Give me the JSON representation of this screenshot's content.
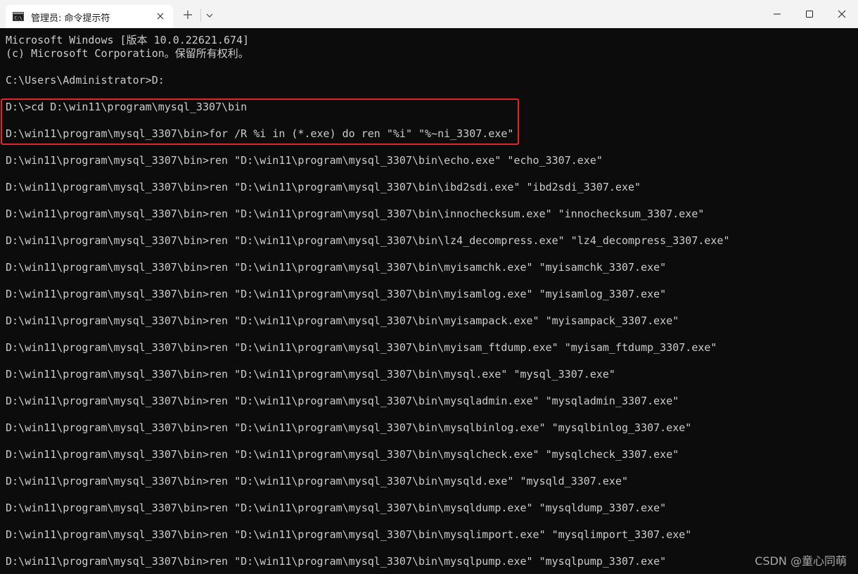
{
  "window": {
    "tab_title": "管理员: 命令提示符",
    "tab_icon": "cmd-icon",
    "controls": {
      "new_tab": "plus-icon",
      "dropdown": "chevron-down-icon",
      "minimize": "minimize-icon",
      "maximize": "maximize-icon",
      "close": "close-icon"
    }
  },
  "terminal": {
    "lines": [
      "Microsoft Windows [版本 10.0.22621.674]",
      "(c) Microsoft Corporation。保留所有权利。",
      "",
      "C:\\Users\\Administrator>D:",
      "",
      "D:\\>cd D:\\win11\\program\\mysql_3307\\bin",
      "",
      "D:\\win11\\program\\mysql_3307\\bin>for /R %i in (*.exe) do ren \"%i\" \"%~ni_3307.exe\"",
      "",
      "D:\\win11\\program\\mysql_3307\\bin>ren \"D:\\win11\\program\\mysql_3307\\bin\\echo.exe\" \"echo_3307.exe\"",
      "",
      "D:\\win11\\program\\mysql_3307\\bin>ren \"D:\\win11\\program\\mysql_3307\\bin\\ibd2sdi.exe\" \"ibd2sdi_3307.exe\"",
      "",
      "D:\\win11\\program\\mysql_3307\\bin>ren \"D:\\win11\\program\\mysql_3307\\bin\\innochecksum.exe\" \"innochecksum_3307.exe\"",
      "",
      "D:\\win11\\program\\mysql_3307\\bin>ren \"D:\\win11\\program\\mysql_3307\\bin\\lz4_decompress.exe\" \"lz4_decompress_3307.exe\"",
      "",
      "D:\\win11\\program\\mysql_3307\\bin>ren \"D:\\win11\\program\\mysql_3307\\bin\\myisamchk.exe\" \"myisamchk_3307.exe\"",
      "",
      "D:\\win11\\program\\mysql_3307\\bin>ren \"D:\\win11\\program\\mysql_3307\\bin\\myisamlog.exe\" \"myisamlog_3307.exe\"",
      "",
      "D:\\win11\\program\\mysql_3307\\bin>ren \"D:\\win11\\program\\mysql_3307\\bin\\myisampack.exe\" \"myisampack_3307.exe\"",
      "",
      "D:\\win11\\program\\mysql_3307\\bin>ren \"D:\\win11\\program\\mysql_3307\\bin\\myisam_ftdump.exe\" \"myisam_ftdump_3307.exe\"",
      "",
      "D:\\win11\\program\\mysql_3307\\bin>ren \"D:\\win11\\program\\mysql_3307\\bin\\mysql.exe\" \"mysql_3307.exe\"",
      "",
      "D:\\win11\\program\\mysql_3307\\bin>ren \"D:\\win11\\program\\mysql_3307\\bin\\mysqladmin.exe\" \"mysqladmin_3307.exe\"",
      "",
      "D:\\win11\\program\\mysql_3307\\bin>ren \"D:\\win11\\program\\mysql_3307\\bin\\mysqlbinlog.exe\" \"mysqlbinlog_3307.exe\"",
      "",
      "D:\\win11\\program\\mysql_3307\\bin>ren \"D:\\win11\\program\\mysql_3307\\bin\\mysqlcheck.exe\" \"mysqlcheck_3307.exe\"",
      "",
      "D:\\win11\\program\\mysql_3307\\bin>ren \"D:\\win11\\program\\mysql_3307\\bin\\mysqld.exe\" \"mysqld_3307.exe\"",
      "",
      "D:\\win11\\program\\mysql_3307\\bin>ren \"D:\\win11\\program\\mysql_3307\\bin\\mysqldump.exe\" \"mysqldump_3307.exe\"",
      "",
      "D:\\win11\\program\\mysql_3307\\bin>ren \"D:\\win11\\program\\mysql_3307\\bin\\mysqlimport.exe\" \"mysqlimport_3307.exe\"",
      "",
      "D:\\win11\\program\\mysql_3307\\bin>ren \"D:\\win11\\program\\mysql_3307\\bin\\mysqlpump.exe\" \"mysqlpump_3307.exe\""
    ],
    "text_color": "#cccccc",
    "background": "#0c0c0c",
    "highlight_color": "#e0262b"
  },
  "watermark": "CSDN @童心同萌"
}
